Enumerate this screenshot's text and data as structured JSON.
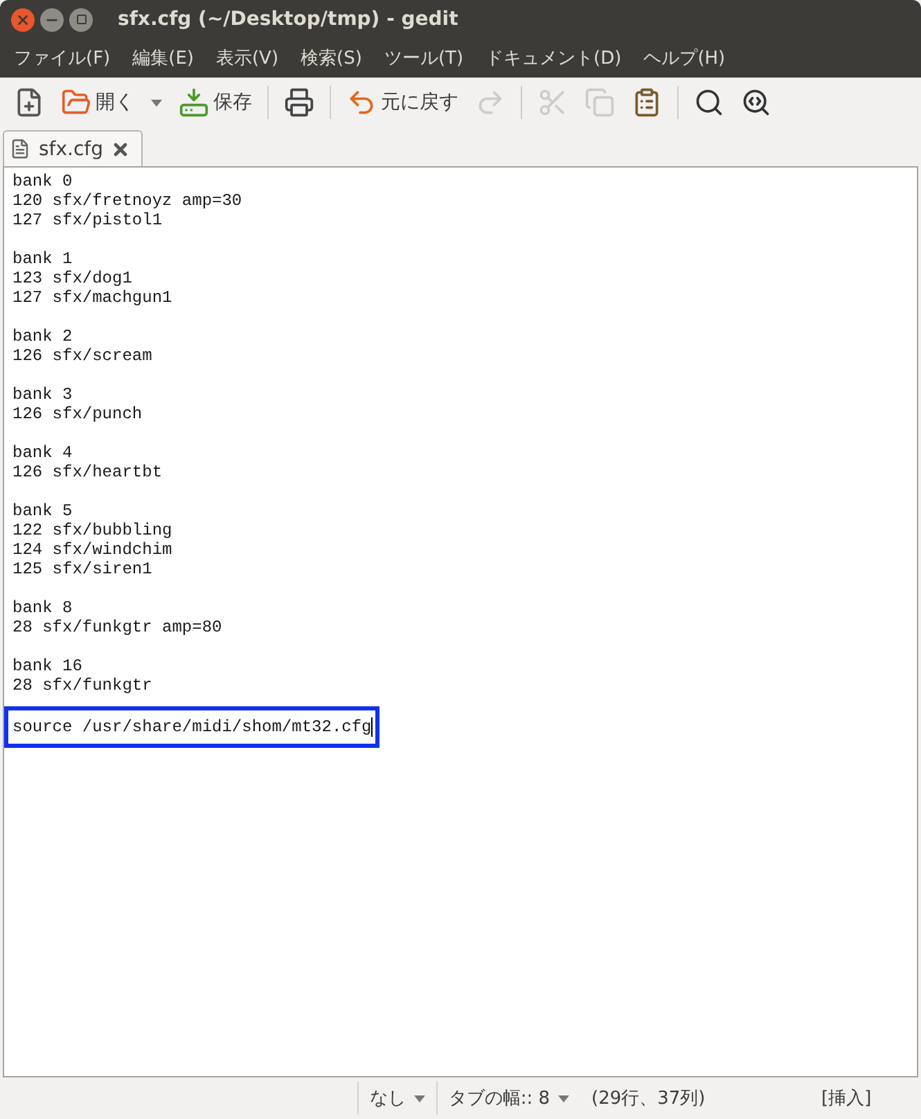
{
  "window": {
    "title": "sfx.cfg (~/Desktop/tmp) - gedit"
  },
  "menu": [
    "ファイル(F)",
    "編集(E)",
    "表示(V)",
    "検索(S)",
    "ツール(T)",
    "ドキュメント(D)",
    "ヘルプ(H)"
  ],
  "toolbar": [
    {
      "kind": "button",
      "disabled": false
    },
    {
      "kind": "button",
      "label": "開く",
      "disabled": false
    },
    {
      "kind": "dropdown",
      "disabled": false
    },
    {
      "kind": "button",
      "label": "保存",
      "disabled": false
    },
    {
      "kind": "separator"
    },
    {
      "kind": "button",
      "disabled": false
    },
    {
      "kind": "separator"
    },
    {
      "kind": "button",
      "label": "元に戻す",
      "disabled": false
    },
    {
      "kind": "button",
      "disabled": true
    },
    {
      "kind": "separator"
    },
    {
      "kind": "button",
      "disabled": true
    },
    {
      "kind": "button",
      "disabled": true
    },
    {
      "kind": "button",
      "disabled": false
    },
    {
      "kind": "separator"
    },
    {
      "kind": "button",
      "disabled": false
    },
    {
      "kind": "button",
      "disabled": false
    }
  ],
  "tabs": [
    {
      "label": "sfx.cfg",
      "selected": true
    }
  ],
  "editor": {
    "lines": [
      {
        "kind": "text",
        "text": "bank 0"
      },
      {
        "kind": "text",
        "text": "120 sfx/fretnoyz amp=30"
      },
      {
        "kind": "text",
        "text": "127 sfx/pistol1"
      },
      {
        "kind": "blank"
      },
      {
        "kind": "text",
        "text": "bank 1"
      },
      {
        "kind": "text",
        "text": "123 sfx/dog1"
      },
      {
        "kind": "text",
        "text": "127 sfx/machgun1"
      },
      {
        "kind": "blank"
      },
      {
        "kind": "text",
        "text": "bank 2"
      },
      {
        "kind": "text",
        "text": "126 sfx/scream"
      },
      {
        "kind": "blank"
      },
      {
        "kind": "text",
        "text": "bank 3"
      },
      {
        "kind": "text",
        "text": "126 sfx/punch"
      },
      {
        "kind": "blank"
      },
      {
        "kind": "text",
        "text": "bank 4"
      },
      {
        "kind": "text",
        "text": "126 sfx/heartbt"
      },
      {
        "kind": "blank"
      },
      {
        "kind": "text",
        "text": "bank 5"
      },
      {
        "kind": "text",
        "text": "122 sfx/bubbling"
      },
      {
        "kind": "text",
        "text": "124 sfx/windchim"
      },
      {
        "kind": "text",
        "text": "125 sfx/siren1"
      },
      {
        "kind": "blank"
      },
      {
        "kind": "text",
        "text": "bank 8"
      },
      {
        "kind": "text",
        "text": "28 sfx/funkgtr amp=80"
      },
      {
        "kind": "blank"
      },
      {
        "kind": "text",
        "text": "bank 16"
      },
      {
        "kind": "text",
        "text": "28 sfx/funkgtr"
      },
      {
        "kind": "blank"
      },
      {
        "kind": "text",
        "text": "source /usr/share/midi/shom/mt32.cfg",
        "highlighted": true
      }
    ]
  },
  "status_bar": [
    {
      "kind": "dropdown",
      "label": "なし"
    },
    {
      "kind": "dropdown",
      "label": "タブの幅:: 8"
    },
    {
      "kind": "text",
      "label": "(29行、37列)"
    },
    {
      "kind": "text",
      "label": "[挿入]"
    }
  ]
}
